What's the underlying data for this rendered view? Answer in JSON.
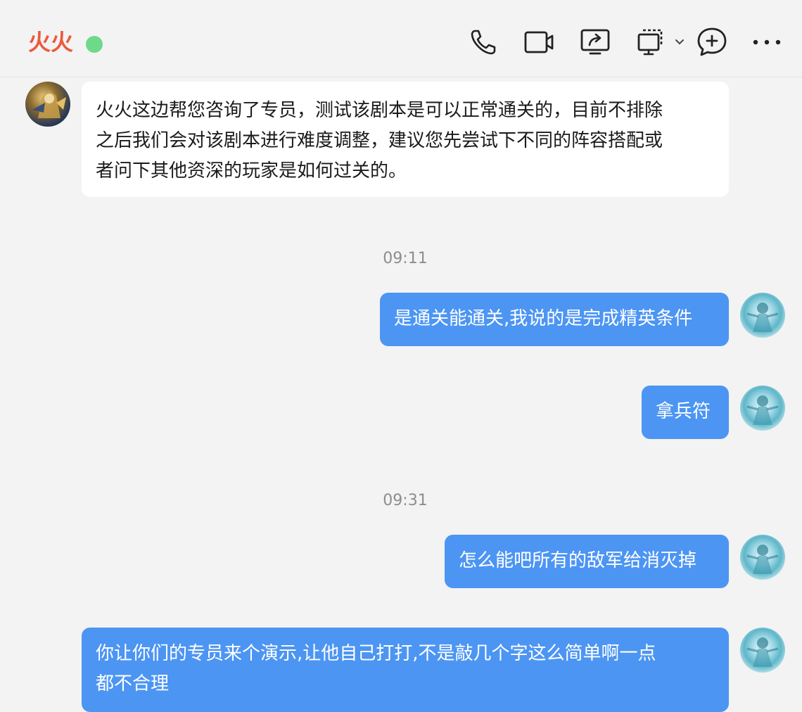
{
  "header": {
    "contact_name": "火火",
    "status": "online",
    "actions": [
      "phone-icon",
      "video-icon",
      "screen-share-icon",
      "remote-assist-icon",
      "add-chat-icon",
      "more-icon"
    ]
  },
  "colors": {
    "name": "#ec5a3c",
    "online": "#6fd98a",
    "outgoing_bubble": "#4c95f3",
    "incoming_bubble": "#ffffff",
    "background": "#f3f3f3"
  },
  "messages": [
    {
      "direction": "incoming",
      "text": "火火这边帮您咨询了专员，测试该剧本是可以正常通关的，目前不排除\n之后我们会对该剧本进行难度调整，建议您先尝试下不同的阵容搭配或\n者问下其他资深的玩家是如何过关的。"
    },
    {
      "type": "time",
      "text": "09:11"
    },
    {
      "direction": "outgoing",
      "text": "是通关能通关,我说的是完成精英条件"
    },
    {
      "direction": "outgoing",
      "text": "拿兵符"
    },
    {
      "type": "time",
      "text": "09:31"
    },
    {
      "direction": "outgoing",
      "text": "怎么能吧所有的敌军给消灭掉"
    },
    {
      "direction": "outgoing",
      "text": "你让你们的专员来个演示,让他自己打打,不是敲几个字这么简单啊一点\n都不合理"
    }
  ]
}
